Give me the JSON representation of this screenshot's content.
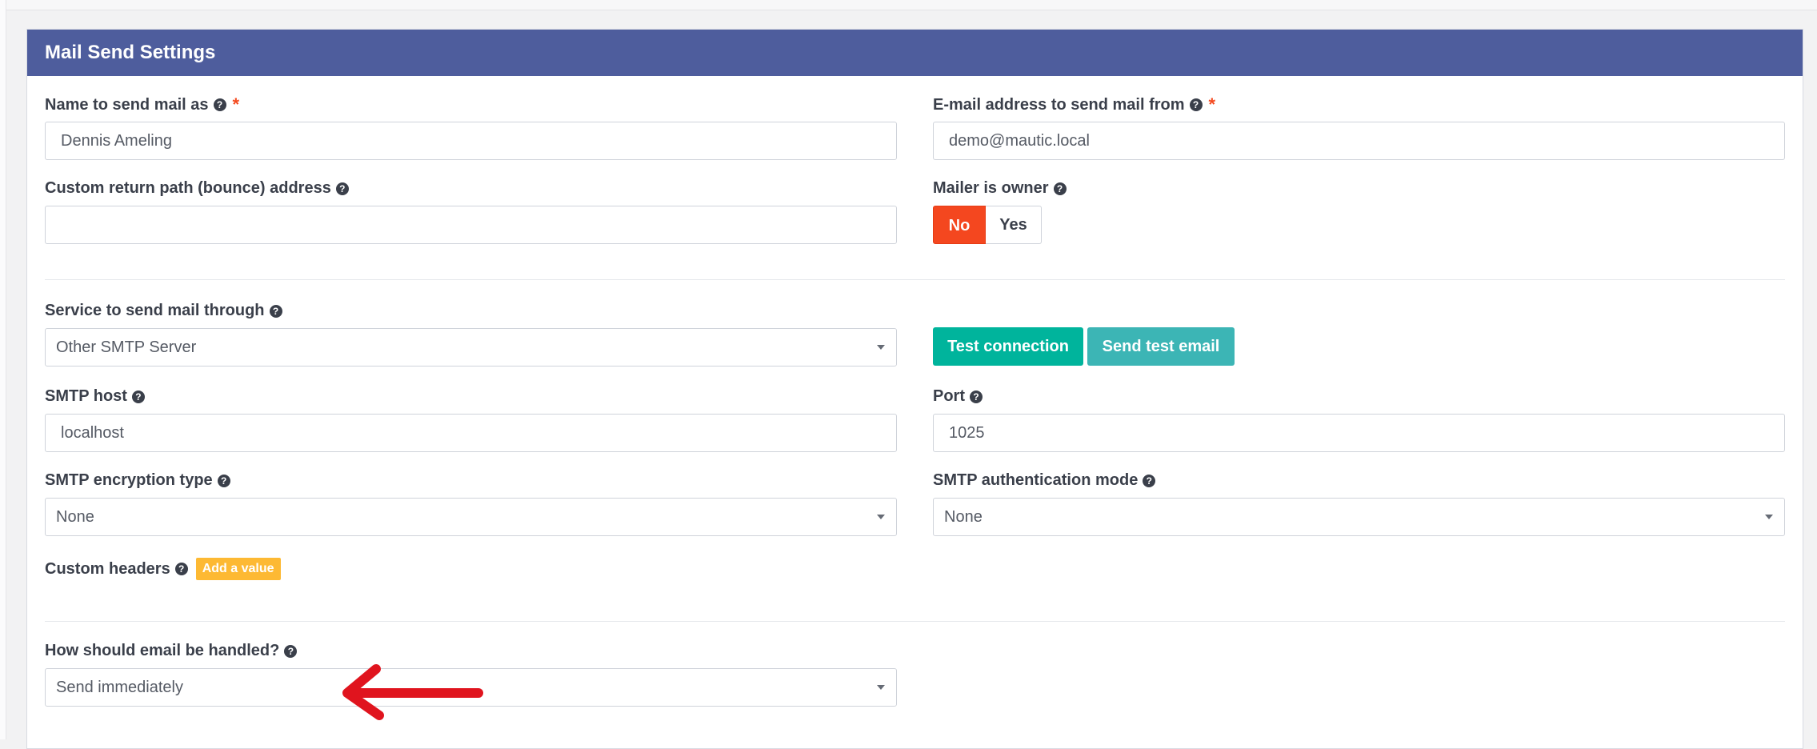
{
  "panel": {
    "title": "Mail Send Settings"
  },
  "fields": {
    "name_label": "Name to send mail as",
    "name_value": "Dennis Ameling",
    "email_label": "E-mail address to send mail from",
    "email_value": "demo@mautic.local",
    "return_path_label": "Custom return path (bounce) address",
    "return_path_value": "",
    "mailer_owner_label": "Mailer is owner",
    "mailer_owner_no": "No",
    "mailer_owner_yes": "Yes",
    "mailer_owner_selected": "No",
    "service_label": "Service to send mail through",
    "service_value": "Other SMTP Server",
    "test_connection": "Test connection",
    "send_test_email": "Send test email",
    "smtp_host_label": "SMTP host",
    "smtp_host_value": "localhost",
    "port_label": "Port",
    "port_value": "1025",
    "encryption_label": "SMTP encryption type",
    "encryption_value": "None",
    "auth_label": "SMTP authentication mode",
    "auth_value": "None",
    "headers_label": "Custom headers",
    "add_value": "Add a value",
    "handling_label": "How should email be handled?",
    "handling_value": "Send immediately"
  },
  "icons": {
    "help": "question-circle-icon",
    "required": "asterisk",
    "caret": "chevron-down-icon",
    "annotation": "red-arrow-left"
  },
  "colors": {
    "header_bg": "#4e5d9d",
    "toggle_active": "#f4471f",
    "test_connection_bg": "#00b49c",
    "send_test_bg": "#3cb5b5",
    "badge_bg": "#fdb933",
    "annotation_arrow": "#e0141e"
  }
}
